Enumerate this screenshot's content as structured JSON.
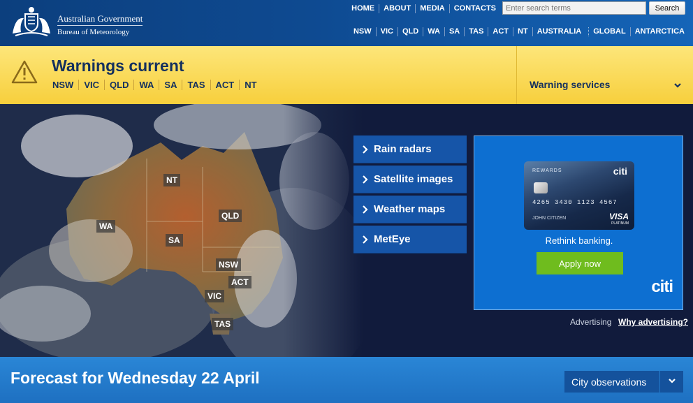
{
  "header": {
    "org_line1": "Australian Government",
    "org_line2": "Bureau of Meteorology",
    "top_links": [
      "HOME",
      "ABOUT",
      "MEDIA",
      "CONTACTS"
    ],
    "search_placeholder": "Enter search terms",
    "search_button": "Search",
    "regions": [
      "NSW",
      "VIC",
      "QLD",
      "WA",
      "SA",
      "TAS",
      "ACT",
      "NT",
      "AUSTRALIA",
      "GLOBAL",
      "ANTARCTICA"
    ]
  },
  "warnings": {
    "title": "Warnings current",
    "states": [
      "NSW",
      "VIC",
      "QLD",
      "WA",
      "SA",
      "TAS",
      "ACT",
      "NT"
    ],
    "services_label": "Warning services"
  },
  "map": {
    "labels": [
      "NT",
      "WA",
      "QLD",
      "SA",
      "NSW",
      "ACT",
      "VIC",
      "TAS"
    ]
  },
  "quick_links": [
    "Rain radars",
    "Satellite images",
    "Weather maps",
    "MetEye"
  ],
  "ad": {
    "card_rewards": "REWARDS",
    "card_logo": "citi",
    "card_number": "4265 3430 1123 4567",
    "card_name": "JOHN CITIZEN",
    "card_visa": "VISA",
    "card_platinum": "PLATINUM",
    "tagline": "Rethink banking.",
    "cta": "Apply now",
    "brand": "citi",
    "note": "Advertising",
    "why": "Why advertising?"
  },
  "forecast": {
    "title": "Forecast for Wednesday 22 April",
    "city_obs": "City observations"
  },
  "colors": {
    "header_blue": "#0e4a91",
    "warning_yellow": "#f7cf3c",
    "link_blue": "#1655a8",
    "forecast_blue": "#1e70c1",
    "cta_green": "#6fbc1e"
  }
}
